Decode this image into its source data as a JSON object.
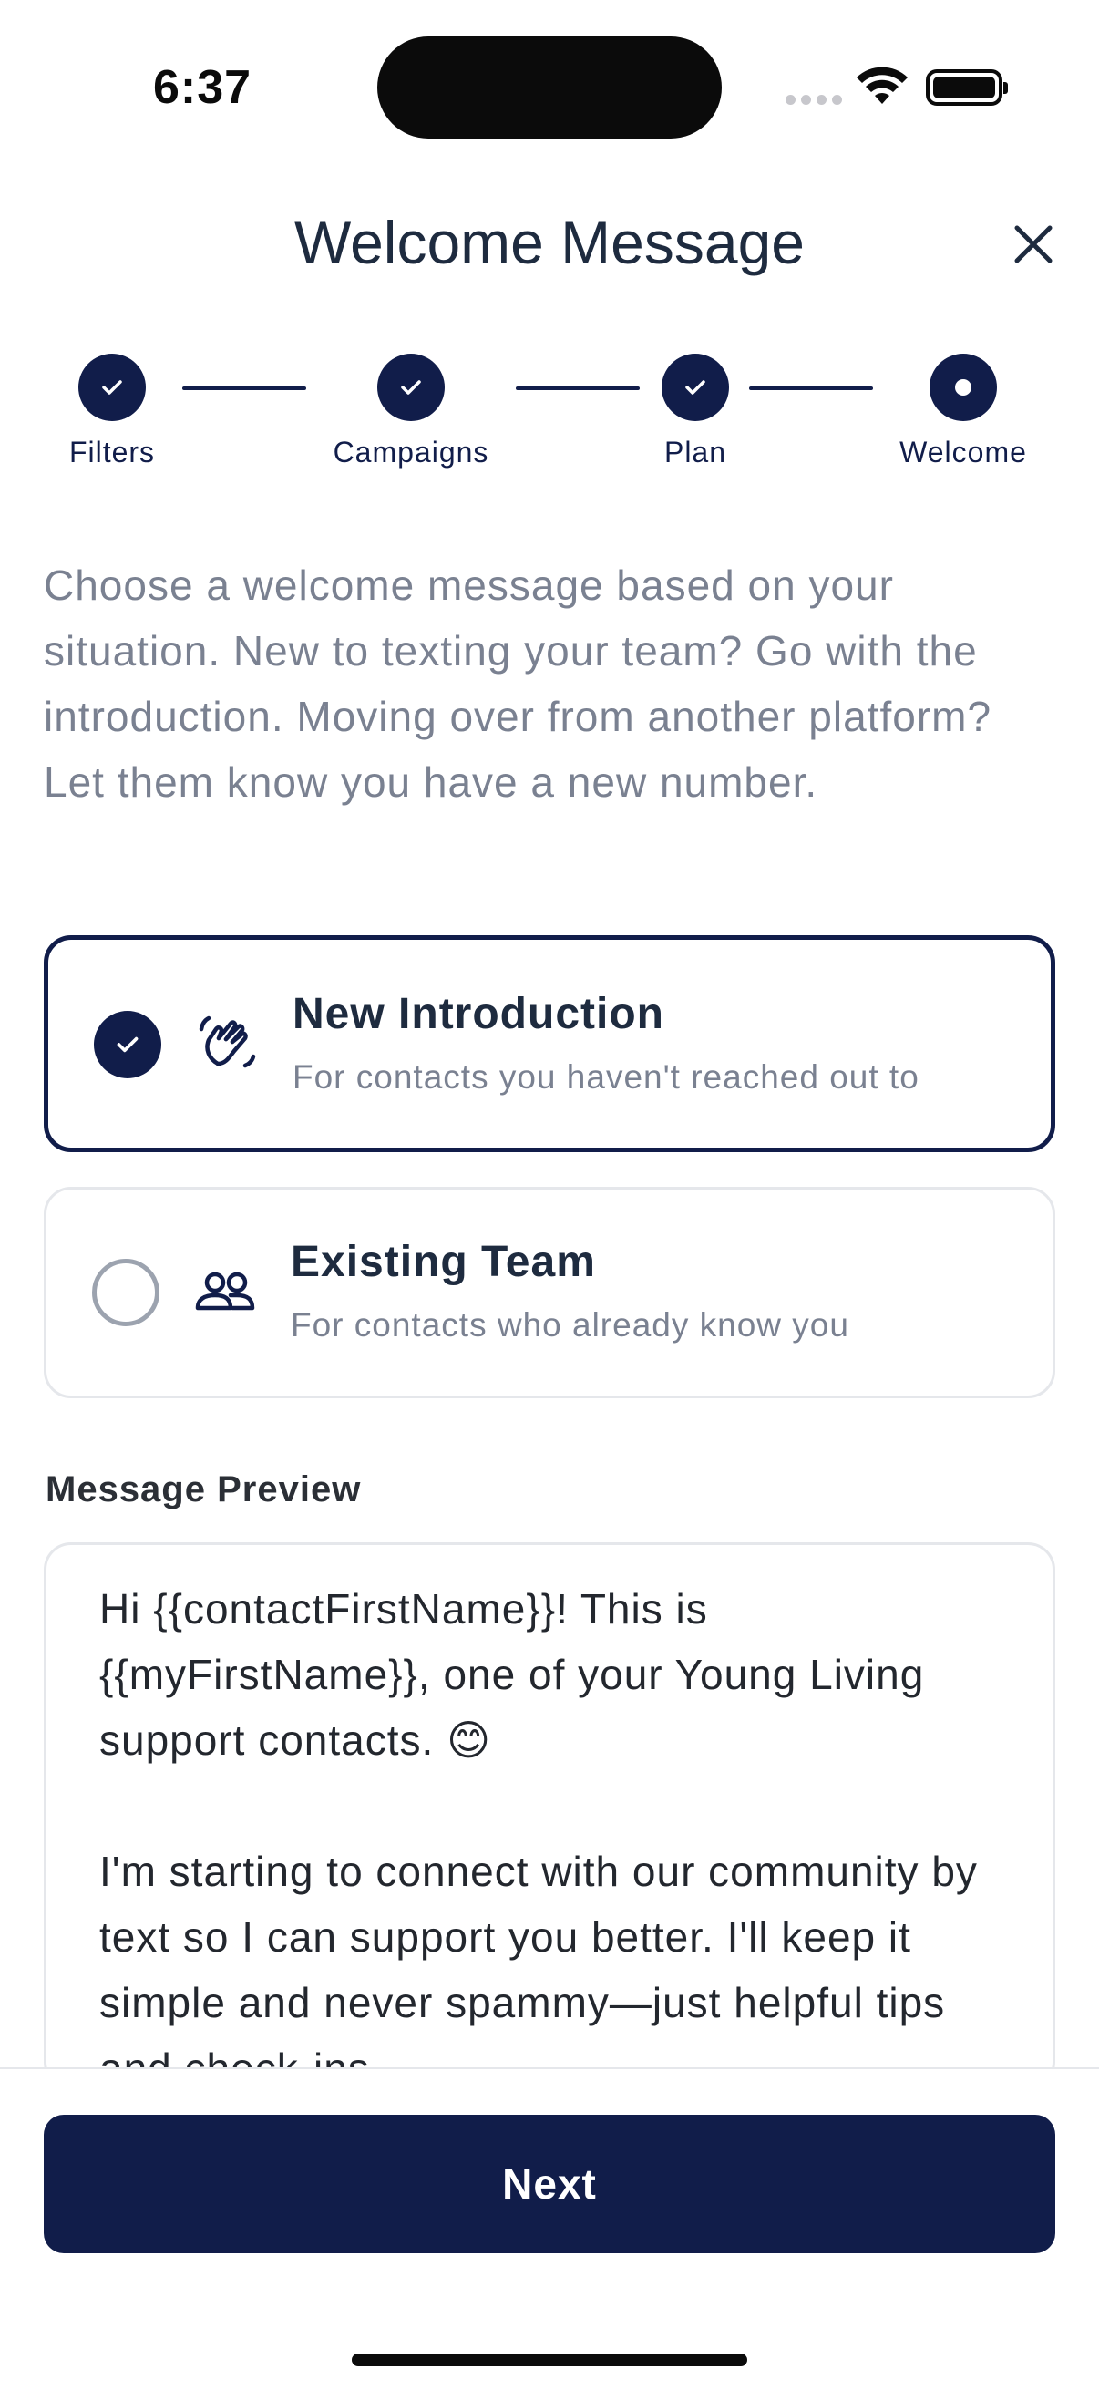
{
  "status_bar": {
    "time": "6:37"
  },
  "header": {
    "title": "Welcome Message"
  },
  "stepper": {
    "steps": [
      {
        "label": "Filters",
        "state": "complete"
      },
      {
        "label": "Campaigns",
        "state": "complete"
      },
      {
        "label": "Plan",
        "state": "complete"
      },
      {
        "label": "Welcome",
        "state": "current"
      }
    ]
  },
  "description": "Choose a welcome message based on your situation. New to texting your team? Go with the introduction. Moving over from another platform? Let them know you have a new number.",
  "options": [
    {
      "title": "New Introduction",
      "subtitle": "For contacts you haven't reached out to",
      "selected": true,
      "icon": "waving-hand-icon"
    },
    {
      "title": "Existing Team",
      "subtitle": "For contacts who already know you",
      "selected": false,
      "icon": "users-icon"
    }
  ],
  "preview": {
    "label": "Message Preview",
    "text": "Hi {{contactFirstName}}! This is {{myFirstName}}, one of your Young Living support contacts. 😊\n\nI'm starting to connect with our community by text so I can support you better. I'll keep it simple and never spammy—just helpful tips and check-ins."
  },
  "footer": {
    "next_label": "Next"
  },
  "colors": {
    "primary": "#111d4a",
    "muted_text": "#7a8191",
    "border": "#e5e7eb"
  }
}
